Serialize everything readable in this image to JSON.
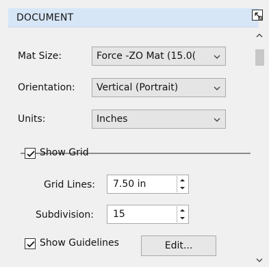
{
  "panel": {
    "title": "DOCUMENT",
    "mat_size": {
      "label": "Mat Size:",
      "value": "Force -ZO Mat (15.0("
    },
    "orientation": {
      "label": "Orientation:",
      "value": "Vertical (Portrait)"
    },
    "units": {
      "label": "Units:",
      "value": "Inches"
    },
    "show_grid": {
      "label": "Show Grid",
      "checked": true
    },
    "grid_lines": {
      "label": "Grid Lines:",
      "value": "7.50 in"
    },
    "subdivision": {
      "label": "Subdivision:",
      "value": "15"
    },
    "show_guidelines": {
      "label": "Show Guidelines",
      "checked": true
    },
    "edit_button": {
      "label": "Edit..."
    }
  },
  "icons": {
    "popout": "popout-icon",
    "chevron": "chevron-down-icon",
    "checkmark": "checkmark-icon",
    "spinner_up": "spinner-up-icon",
    "spinner_down": "spinner-down-icon",
    "scroll_up": "scroll-up-icon",
    "scroll_down": "scroll-down-icon"
  },
  "colors": {
    "header_bg": "#d7e6f6",
    "panel_bg": "#f0f0f0",
    "field_border": "#a9a9a9"
  }
}
